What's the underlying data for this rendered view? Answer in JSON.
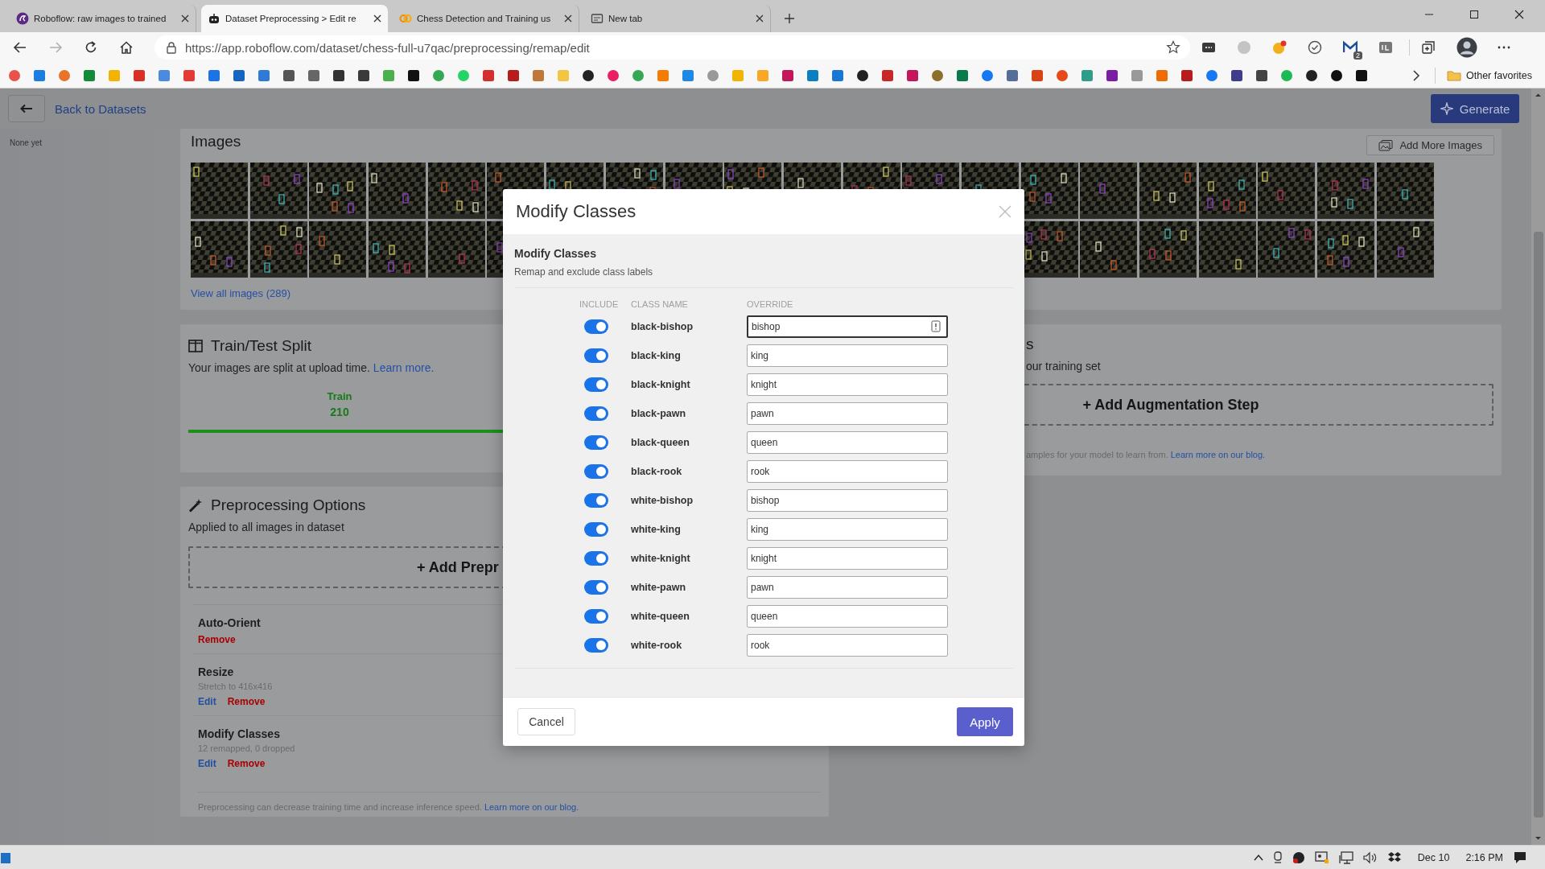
{
  "browser": {
    "tabs": [
      {
        "title": "Roboflow: raw images to trained",
        "kind": "roboflow",
        "selected": false
      },
      {
        "title": "Dataset Preprocessing > Edit re",
        "kind": "robot",
        "selected": true
      },
      {
        "title": "Chess Detection and Training us",
        "kind": "colab",
        "selected": false
      },
      {
        "title": "New tab",
        "kind": "page",
        "selected": false
      }
    ],
    "url": "https://app.roboflow.com/dataset/chess-full-u7qac/preprocessing/remap/edit",
    "extension_badge": "2",
    "other_favorites": "Other favorites"
  },
  "page": {
    "back_label": "Back to Datasets",
    "sidebar_note": "None yet",
    "generate": "Generate",
    "images": {
      "title": "Images",
      "add_more": "Add More Images",
      "view_all": "View all images (289)"
    },
    "train_test": {
      "title": "Train/Test Split",
      "description": "Your images are split at upload time.",
      "link": "Learn more.",
      "train_label": "Train",
      "train_count": "210"
    },
    "preprocessing": {
      "title": "Preprocessing Options",
      "subtitle": "Applied to all images in dataset",
      "add_step": "+ Add Prepr",
      "steps": [
        {
          "name": "Auto-Orient",
          "actions": [
            {
              "label": "Remove",
              "kind": "remove"
            }
          ]
        },
        {
          "name": "Resize",
          "detail": "Stretch to 416x416",
          "actions": [
            {
              "label": "Edit",
              "kind": "edit"
            },
            {
              "label": "Remove",
              "kind": "remove"
            }
          ]
        },
        {
          "name": "Modify Classes",
          "detail": "12 remapped, 0 dropped",
          "actions": [
            {
              "label": "Edit",
              "kind": "edit"
            },
            {
              "label": "Remove",
              "kind": "remove"
            }
          ]
        }
      ],
      "note": "Preprocessing can decrease training time and increase inference speed.",
      "note_link": "Learn more on our blog."
    },
    "augmentation": {
      "title_fragment": "s",
      "subtitle_fragment": "our training set",
      "add_step": "+ Add Augmentation Step",
      "note": "amples for your model to learn from.",
      "note_link": "Learn more on our blog."
    }
  },
  "modal": {
    "title": "Modify Classes",
    "section_title": "Modify Classes",
    "section_subtitle": "Remap and exclude class labels",
    "columns": [
      "INCLUDE",
      "CLASS NAME",
      "OVERRIDE"
    ],
    "rows": [
      {
        "include": true,
        "class_name": "black-bishop",
        "override": "bishop",
        "focused": true
      },
      {
        "include": true,
        "class_name": "black-king",
        "override": "king",
        "focused": false
      },
      {
        "include": true,
        "class_name": "black-knight",
        "override": "knight",
        "focused": false
      },
      {
        "include": true,
        "class_name": "black-pawn",
        "override": "pawn",
        "focused": false
      },
      {
        "include": true,
        "class_name": "black-queen",
        "override": "queen",
        "focused": false
      },
      {
        "include": true,
        "class_name": "black-rook",
        "override": "rook",
        "focused": false
      },
      {
        "include": true,
        "class_name": "white-bishop",
        "override": "bishop",
        "focused": false
      },
      {
        "include": true,
        "class_name": "white-king",
        "override": "king",
        "focused": false
      },
      {
        "include": true,
        "class_name": "white-knight",
        "override": "knight",
        "focused": false
      },
      {
        "include": true,
        "class_name": "white-pawn",
        "override": "pawn",
        "focused": false
      },
      {
        "include": true,
        "class_name": "white-queen",
        "override": "queen",
        "focused": false
      },
      {
        "include": true,
        "class_name": "white-rook",
        "override": "rook",
        "focused": false
      }
    ],
    "cancel": "Cancel",
    "apply": "Apply"
  },
  "taskbar": {
    "date": "Dec 10",
    "time": "2:16 PM"
  }
}
